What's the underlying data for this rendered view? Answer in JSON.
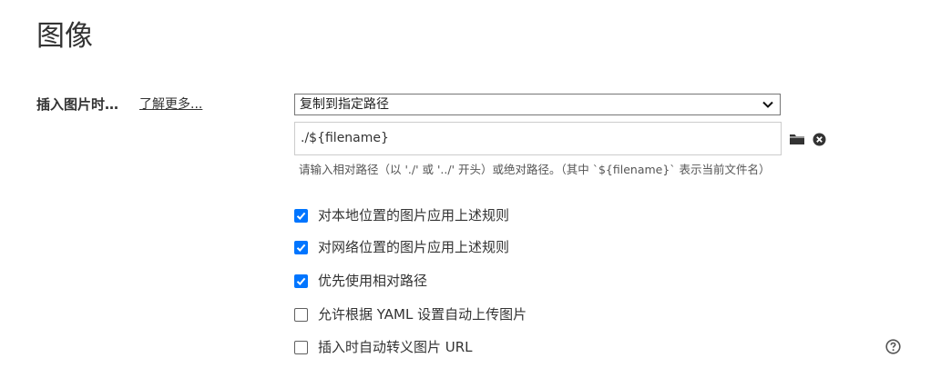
{
  "section": {
    "title": "图像"
  },
  "insert_image": {
    "label": "插入图片时…",
    "learn_more": "了解更多..."
  },
  "action_select": {
    "selected": "复制到指定路径"
  },
  "path_field": {
    "value": "./${filename}"
  },
  "hint": "请输入相对路径（以 './' 或 '../' 开头）或绝对路径。（其中 `${filename}` 表示当前文件名）",
  "options": [
    {
      "label": "对本地位置的图片应用上述规则",
      "checked": true
    },
    {
      "label": "对网络位置的图片应用上述规则",
      "checked": true
    },
    {
      "label": "优先使用相对路径",
      "checked": true
    },
    {
      "label": "允许根据 YAML 设置自动上传图片",
      "checked": false
    },
    {
      "label": "插入时自动转义图片 URL",
      "checked": false
    }
  ],
  "icons": {
    "folder": "folder-icon",
    "clear": "close-circle-icon",
    "help": "help-circle-icon",
    "dropdown": "chevron-down-icon"
  },
  "colors": {
    "checkbox_checked": "#0075ff",
    "text": "#333333"
  }
}
